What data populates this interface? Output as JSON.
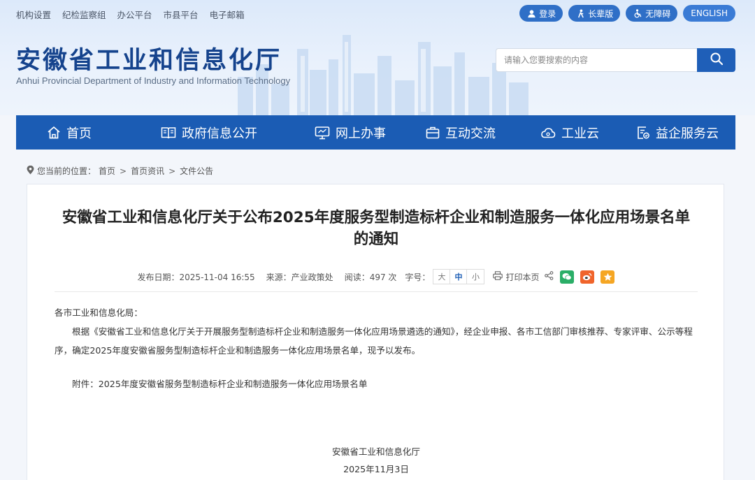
{
  "top_links": [
    "机构设置",
    "纪检监察组",
    "办公平台",
    "市县平台",
    "电子邮箱"
  ],
  "top_buttons": {
    "login": "登录",
    "elder": "长辈版",
    "accessible": "无障碍",
    "english": "ENGLISH"
  },
  "site": {
    "title": "安徽省工业和信息化厅",
    "subtitle": "Anhui Provincial Department of Industry and Information Technology"
  },
  "search": {
    "placeholder": "请输入您要搜索的内容",
    "value": ""
  },
  "nav": [
    "首页",
    "政府信息公开",
    "网上办事",
    "互动交流",
    "工业云",
    "益企服务云"
  ],
  "breadcrumb": {
    "prefix": "您当前的位置：",
    "items": [
      "首页",
      "首页资讯",
      "文件公告"
    ],
    "sep": ">"
  },
  "article": {
    "title": "安徽省工业和信息化厅关于公布2025年度服务型制造标杆企业和制造服务一体化应用场景名单的通知",
    "meta": {
      "date": "发布日期：2025-11-04 16:55",
      "source": "来源：产业政策处",
      "reads": "阅读：497 次",
      "font_label": "字号：",
      "sizes": [
        "大",
        "中",
        "小"
      ],
      "selected_size": "中",
      "print": "打印本页"
    },
    "salutation": "各市工业和信息化局：",
    "paragraph": "根据《安徽省工业和信息化厅关于开展服务型制造标杆企业和制造服务一体化应用场景遴选的通知》，经企业申报、各市工信部门审核推荐、专家评审、公示等程序，确定2025年度安徽省服务型制造标杆企业和制造服务一体化应用场景名单，现予以发布。",
    "attachment": "附件：2025年度安徽省服务型制造标杆企业和制造服务一体化应用场景名单",
    "signature": "安徽省工业和信息化厅",
    "sign_date": "2025年11月3日"
  },
  "colors": {
    "nav_bg": "#1b5cb4",
    "title_blue": "#15438d",
    "pill_blue": "#2f6fc7",
    "wechat_green": "#2aae67",
    "weibo_orange": "#f0642b",
    "fav_orange": "#f5a623"
  },
  "icons": {
    "nav": [
      "home-icon",
      "book-icon",
      "monitor-icon",
      "briefcase-icon",
      "cloud-icon",
      "service-icon"
    ],
    "share": [
      "share-icon",
      "wechat-icon",
      "weibo-icon",
      "favorite-star-icon"
    ]
  }
}
